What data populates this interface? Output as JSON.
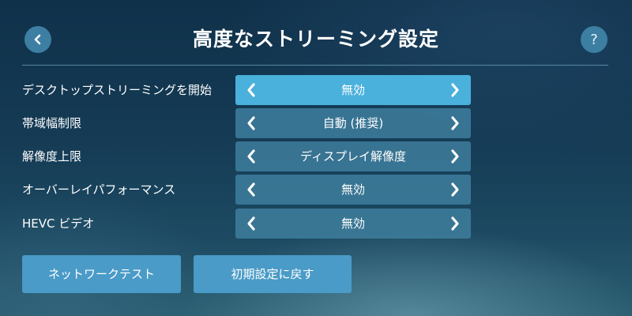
{
  "header": {
    "title": "高度なストリーミング設定",
    "back_icon": "chevron-left-icon",
    "help_label": "?"
  },
  "settings": [
    {
      "label": "デスクトップストリーミングを開始",
      "value": "無効",
      "active": true
    },
    {
      "label": "帯域幅制限",
      "value": "自動 (推奨)",
      "active": false
    },
    {
      "label": "解像度上限",
      "value": "ディスプレイ解像度",
      "active": false
    },
    {
      "label": "オーバーレイパフォーマンス",
      "value": "無効",
      "active": false
    },
    {
      "label": "HEVC ビデオ",
      "value": "無効",
      "active": false
    }
  ],
  "actions": {
    "network_test": "ネットワークテスト",
    "reset_defaults": "初期設定に戻す"
  },
  "colors": {
    "selector_active": "#4ab0dc",
    "selector": "#3f80a0",
    "button": "#4a9bc7",
    "circle_button": "#3d7ea3"
  }
}
